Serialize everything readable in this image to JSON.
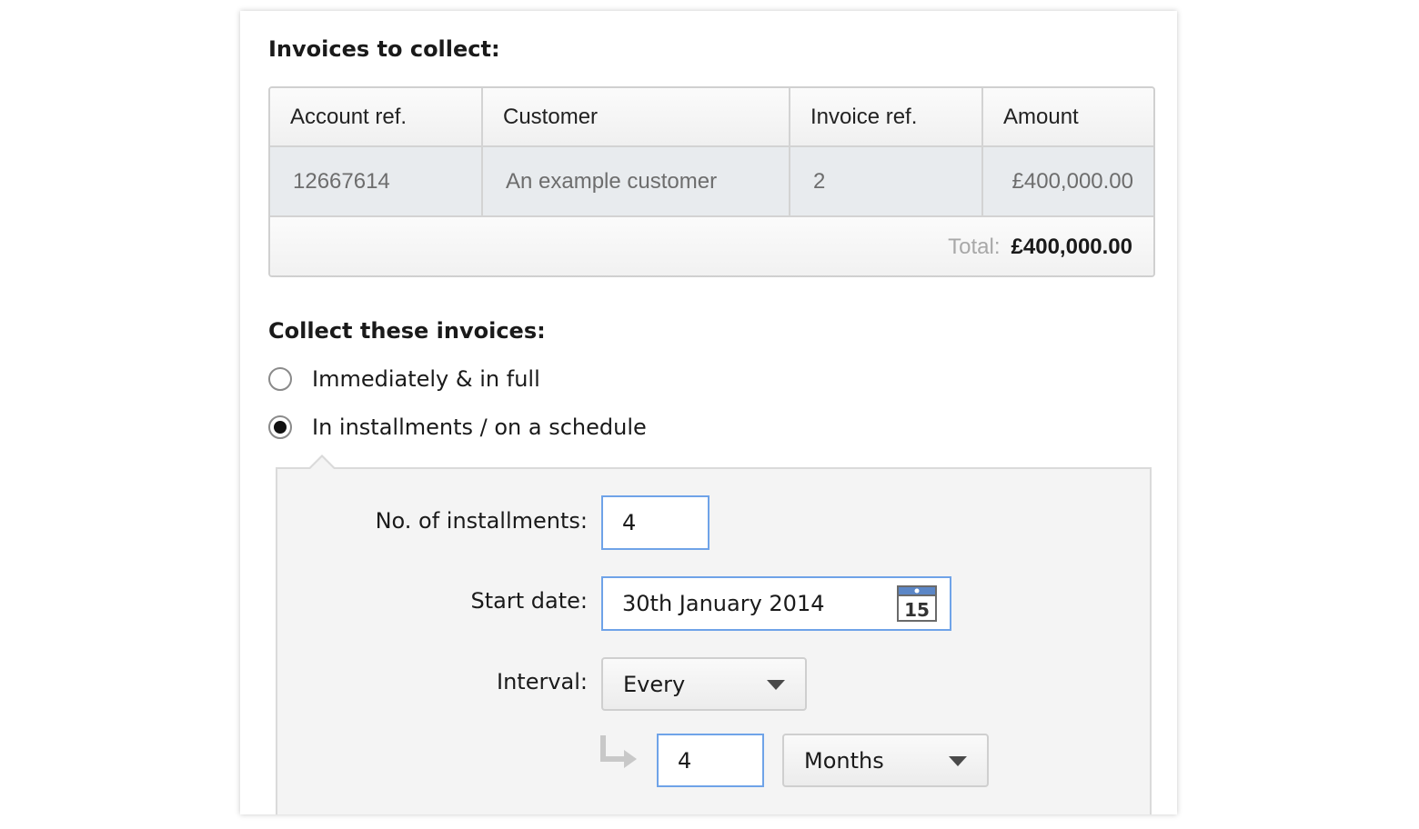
{
  "invoices": {
    "heading": "Invoices to collect:",
    "columns": [
      "Account ref.",
      "Customer",
      "Invoice ref.",
      "Amount"
    ],
    "rows": [
      {
        "account_ref": "12667614",
        "customer": "An example customer",
        "invoice_ref": "2",
        "amount": "£400,000.00"
      }
    ],
    "total_label": "Total:",
    "total_value": "£400,000.00"
  },
  "collect": {
    "heading": "Collect these invoices:",
    "options": [
      {
        "label": "Immediately & in full",
        "checked": false
      },
      {
        "label": "In installments / on a schedule",
        "checked": true
      }
    ]
  },
  "schedule": {
    "installments_label": "No. of installments:",
    "installments_value": "4",
    "start_date_label": "Start date:",
    "start_date_value": "30th January 2014",
    "calendar_day": "15",
    "interval_label": "Interval:",
    "interval_value": "Every",
    "interval_count": "4",
    "interval_unit": "Months"
  },
  "colors": {
    "input_border": "#6fa3e8",
    "panel_bg": "#f4f4f4",
    "row_bg": "#e8ebee"
  }
}
